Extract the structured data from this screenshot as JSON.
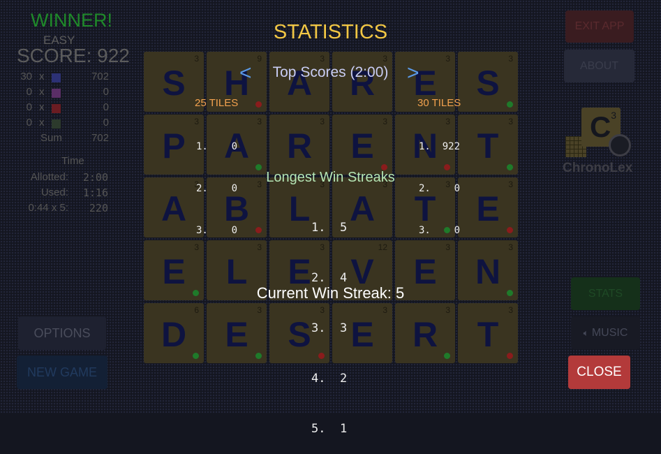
{
  "left_panel": {
    "winner": "WINNER!",
    "difficulty": "EASY",
    "score": "SCORE: 922",
    "breakdown": [
      {
        "count": "30",
        "x": "x",
        "color": "#2c3175",
        "value": "702"
      },
      {
        "count": "0",
        "x": "x",
        "color": "#5a2e66",
        "value": "0"
      },
      {
        "count": "0",
        "x": "x",
        "color": "#6a1c22",
        "value": "0"
      },
      {
        "count": "0",
        "x": "x",
        "color": "#2c3a2c",
        "value": "0"
      }
    ],
    "sum_label": "Sum",
    "sum_value": "702",
    "time_heading": "Time",
    "time_rows": [
      {
        "label": "Allotted:",
        "value": "2:00"
      },
      {
        "label": "Used:",
        "value": "1:16"
      },
      {
        "label": "0:44 x 5:",
        "value": "220"
      }
    ],
    "options_label": "OPTIONS",
    "new_game_label": "NEW GAME"
  },
  "right_panel": {
    "exit_label": "EXIT APP",
    "about_label": "ABOUT",
    "logo_letter": "C",
    "logo_sub": "3",
    "logo_name": "ChronoLex",
    "stats_label": "STATS",
    "music_label": "MUSIC",
    "close_label": "CLOSE"
  },
  "board": {
    "rows": [
      [
        {
          "l": "S",
          "n": "3",
          "c": "none"
        },
        {
          "l": "H",
          "n": "9",
          "c": "red"
        },
        {
          "l": "A",
          "n": "3",
          "c": "none"
        },
        {
          "l": "R",
          "n": "3",
          "c": "none"
        },
        {
          "l": "E",
          "n": "3",
          "c": "none"
        },
        {
          "l": "S",
          "n": "3",
          "c": "green"
        }
      ],
      [
        {
          "l": "P",
          "n": "3",
          "c": "none"
        },
        {
          "l": "A",
          "n": "3",
          "c": "green"
        },
        {
          "l": "R",
          "n": "3",
          "c": "none"
        },
        {
          "l": "E",
          "n": "3",
          "c": "red"
        },
        {
          "l": "N",
          "n": "3",
          "c": "red"
        },
        {
          "l": "T",
          "n": "3",
          "c": "green"
        }
      ],
      [
        {
          "l": "A",
          "n": "3",
          "c": "none"
        },
        {
          "l": "B",
          "n": "3",
          "c": "red"
        },
        {
          "l": "L",
          "n": "3",
          "c": "none"
        },
        {
          "l": "A",
          "n": "3",
          "c": "none"
        },
        {
          "l": "T",
          "n": "3",
          "c": "green"
        },
        {
          "l": "E",
          "n": "3",
          "c": "red"
        }
      ],
      [
        {
          "l": "E",
          "n": "3",
          "c": "green"
        },
        {
          "l": "L",
          "n": "3",
          "c": "none"
        },
        {
          "l": "E",
          "n": "3",
          "c": "none"
        },
        {
          "l": "V",
          "n": "12",
          "c": "none"
        },
        {
          "l": "E",
          "n": "3",
          "c": "none"
        },
        {
          "l": "N",
          "n": "3",
          "c": "green"
        }
      ],
      [
        {
          "l": "D",
          "n": "6",
          "c": "green"
        },
        {
          "l": "E",
          "n": "3",
          "c": "green"
        },
        {
          "l": "S",
          "n": "3",
          "c": "red"
        },
        {
          "l": "E",
          "n": "3",
          "c": "none"
        },
        {
          "l": "R",
          "n": "3",
          "c": "green"
        },
        {
          "l": "T",
          "n": "3",
          "c": "red"
        }
      ]
    ]
  },
  "stats": {
    "title": "STATISTICS",
    "prev": "<",
    "next": ">",
    "top_scores_title": "Top Scores (2:00)",
    "col25_title": "25 TILES",
    "col25_rows": [
      "1.    0",
      "2.    0",
      "3.    0"
    ],
    "col30_title": "30 TILES",
    "col30_rows": [
      "1.  922",
      "2.    0",
      "3.    0"
    ],
    "streaks_title": "Longest Win Streaks",
    "streak_rows": [
      "1.  5",
      "2.  4",
      "3.  3",
      "4.  2",
      "5.  1"
    ],
    "current_streak": "Current Win Streak: 5"
  },
  "colors": {
    "accent_title": "#f2c744",
    "close_button": "#b33a3a",
    "arrow": "#5b9ae8",
    "dot_red": "#8a1c1c",
    "dot_green": "#1f7a2a"
  }
}
